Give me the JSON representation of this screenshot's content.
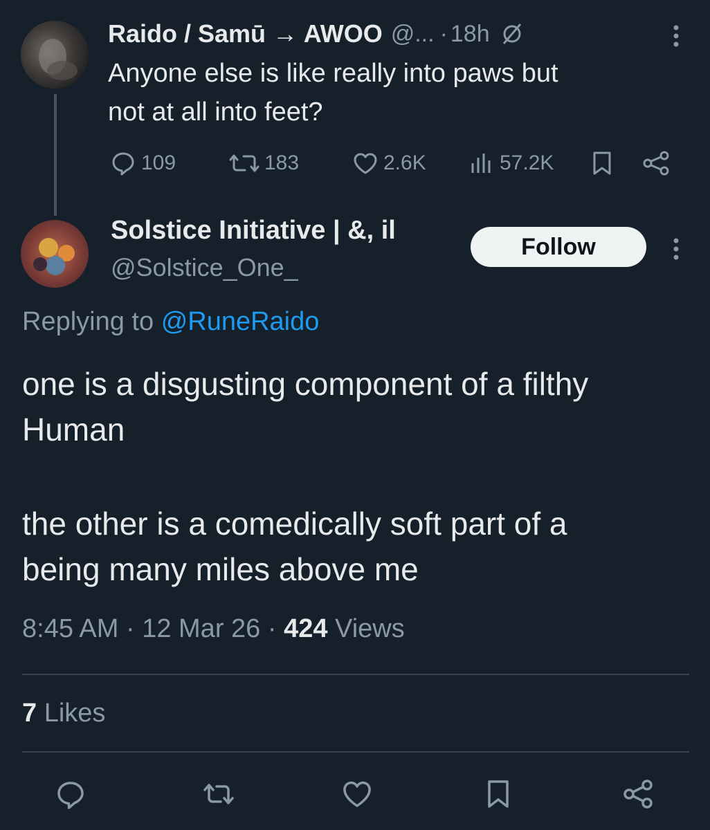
{
  "parent_tweet": {
    "author_name": "Raido / Samū → AWOO",
    "handle": "@...",
    "separator": "·",
    "time": "18h",
    "text": "Anyone else is like really into paws but\nnot at all into feet?",
    "stats": {
      "replies": "109",
      "reposts": "183",
      "likes": "2.6K",
      "views": "57.2K"
    }
  },
  "reply_tweet": {
    "author_name": "Solstice Initiative | &, il",
    "handle": "@Solstice_One_",
    "follow_label": "Follow",
    "replying_prefix": "Replying to",
    "replying_handle": "@RuneRaido",
    "text_p1": "one is a disgusting component of a filthy\nHuman",
    "text_p2": "the other is a comedically soft part of a\nbeing many miles above me",
    "time": "8:45 AM",
    "meta_sep": "·",
    "date": "12 Mar 26",
    "views_count": "424",
    "views_label": "Views",
    "likes_count": "7",
    "likes_label": "Likes"
  },
  "colors": {
    "background": "#15202b",
    "text_primary": "#e7e9ea",
    "text_secondary": "#8b98a5",
    "link": "#1d9bf0",
    "divider": "#38444d",
    "follow_bg": "#eff3f4"
  },
  "icons": [
    "muted-icon",
    "more-icon",
    "reply-icon",
    "repost-icon",
    "like-icon",
    "views-icon",
    "bookmark-icon",
    "share-icon"
  ]
}
